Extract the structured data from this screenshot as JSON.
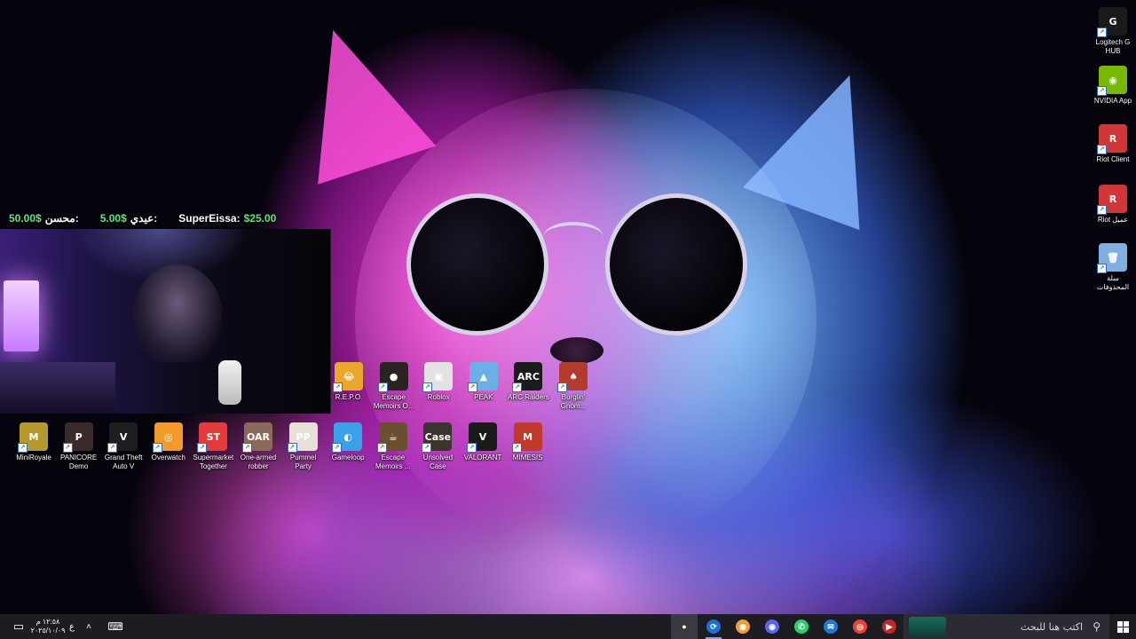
{
  "donations": [
    {
      "name": "SuperEissa:",
      "amount": "$25.00"
    },
    {
      "name": "عيدي:",
      "amount": "5.00$"
    },
    {
      "name": "محسن:",
      "amount": "50.00$"
    }
  ],
  "desktop_icons_right": [
    {
      "label": "Logitech G HUB",
      "icon": "logitech-ghub-icon",
      "color": "#1a1a1a",
      "glyph": "G"
    },
    {
      "label": "NVIDIA App",
      "icon": "nvidia-icon",
      "color": "#76b900",
      "glyph": "◉"
    },
    {
      "label": "Riot Client",
      "icon": "riot-client-icon",
      "color": "#d13639",
      "glyph": "R"
    },
    {
      "label": "Riot عميل",
      "icon": "riot-client-icon",
      "color": "#d13639",
      "glyph": "R"
    },
    {
      "label": "سلة المحذوفات",
      "icon": "recycle-bin-icon",
      "color": "#7fb0e0",
      "glyph": "🗑"
    }
  ],
  "desktop_icons_row1": [
    {
      "label": "R.E.P.O.",
      "icon": "repo-icon",
      "color": "#e8a92a",
      "glyph": "😂"
    },
    {
      "label": "Escape Memoirs O...",
      "icon": "escape-memoirs-icon",
      "color": "#2b2320",
      "glyph": "●"
    },
    {
      "label": "Roblox",
      "icon": "roblox-icon",
      "color": "#e2e2e2",
      "glyph": "▣"
    },
    {
      "label": "PEAK",
      "icon": "peak-icon",
      "color": "#6ab0e6",
      "glyph": "▲"
    },
    {
      "label": "ARC Raiders",
      "icon": "arc-raiders-icon",
      "color": "#1b1b1b",
      "glyph": "ARC"
    },
    {
      "label": "Burglin' Gnom...",
      "icon": "burglin-gnomes-icon",
      "color": "#b33b2d",
      "glyph": "♠"
    }
  ],
  "desktop_icons_row2": [
    {
      "label": "MiniRoyale",
      "icon": "miniroyale-icon",
      "color": "#b49a2c",
      "glyph": "M"
    },
    {
      "label": "PANICORE Demo",
      "icon": "panicore-icon",
      "color": "#3b2a2a",
      "glyph": "P"
    },
    {
      "label": "Grand Theft Auto V",
      "icon": "gta-v-icon",
      "color": "#1e1e1e",
      "glyph": "V"
    },
    {
      "label": "Overwatch",
      "icon": "overwatch-icon",
      "color": "#f29b2b",
      "glyph": "◎"
    },
    {
      "label": "Supermarket Together",
      "icon": "supermarket-together-icon",
      "color": "#e33a3a",
      "glyph": "ST"
    },
    {
      "label": "One-armed robber",
      "icon": "one-armed-robber-icon",
      "color": "#8a6b5a",
      "glyph": "OAR"
    },
    {
      "label": "Pummel Party",
      "icon": "pummel-party-icon",
      "color": "#e8e0d8",
      "glyph": "PP"
    },
    {
      "label": "Gameloop",
      "icon": "gameloop-icon",
      "color": "#3aa0e8",
      "glyph": "◐"
    },
    {
      "label": "Escape Memoirs ...",
      "icon": "escape-memoirs-icon",
      "color": "#6a5030",
      "glyph": "☕"
    },
    {
      "label": "Unsolved Case",
      "icon": "unsolved-case-icon",
      "color": "#3a342c",
      "glyph": "Case"
    },
    {
      "label": "VALORANT",
      "icon": "valorant-icon",
      "color": "#1b1b1b",
      "glyph": "V"
    },
    {
      "label": "MIMESIS",
      "icon": "mimesis-icon",
      "color": "#c0392b",
      "glyph": "M"
    }
  ],
  "taskbar": {
    "search_placeholder": "اكتب هنا للبحث",
    "clock_time": "١٢:٥٨ م",
    "clock_date": "٢٠٢٥/١٠/٠٩",
    "lang": "ع",
    "apps": [
      {
        "name": "obs-icon",
        "color": "#3a3a3a",
        "glyph": "●",
        "state": "active"
      },
      {
        "name": "edge-dev-icon",
        "color": "#1f6fd6",
        "glyph": "⟳",
        "state": "running"
      },
      {
        "name": "discord-ptb-icon",
        "color": "#f0a030",
        "glyph": "◉",
        "state": ""
      },
      {
        "name": "discord-icon",
        "color": "#5865f2",
        "glyph": "◉",
        "state": ""
      },
      {
        "name": "whatsapp-icon",
        "color": "#25d366",
        "glyph": "✆",
        "state": ""
      },
      {
        "name": "mail-icon",
        "color": "#1e78d4",
        "glyph": "✉",
        "state": ""
      },
      {
        "name": "chrome-icon",
        "color": "#e8443a",
        "glyph": "◎",
        "state": ""
      },
      {
        "name": "streamer-app-icon",
        "color": "#c0282a",
        "glyph": "▶",
        "state": ""
      }
    ]
  }
}
